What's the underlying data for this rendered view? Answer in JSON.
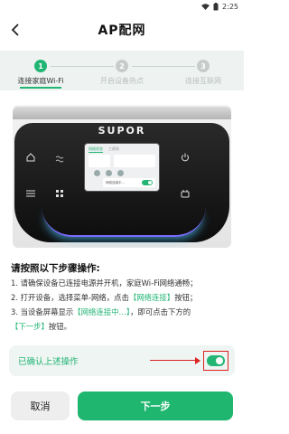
{
  "status_bar": {
    "time": "2:25"
  },
  "header": {
    "title": "AP配网"
  },
  "steps": [
    {
      "number": "1",
      "label": "连接家庭Wi-Fi",
      "active": true
    },
    {
      "number": "2",
      "label": "开启设备热点",
      "active": false
    },
    {
      "number": "3",
      "label": "连接互联网",
      "active": false
    }
  ],
  "device": {
    "brand": "SUPOR",
    "screen": {
      "tabs": [
        "网络状态",
        "工模表"
      ],
      "popup_text": "网络连接中…"
    }
  },
  "instructions": {
    "title": "请按照以下步骤操作:",
    "step1": "1. 请确保设备已连接电源并开机，家庭Wi-Fi网络通畅；",
    "step2_a": "2. 打开设备，选择菜单-网络，点击",
    "step2_hl": "【网络连接】",
    "step2_b": "按钮；",
    "step3_a": "3. 当设备屏幕显示",
    "step3_hl1": "【网络连接中…】",
    "step3_b": "，即可点击下方的",
    "step3_hl2": "【下一步】",
    "step3_c": "按钮。"
  },
  "confirm": {
    "label": "已确认上述操作",
    "checked": true
  },
  "buttons": {
    "cancel": "取消",
    "next": "下一步"
  },
  "colors": {
    "accent": "#1fb66f",
    "highlight_border": "#dd2222"
  }
}
